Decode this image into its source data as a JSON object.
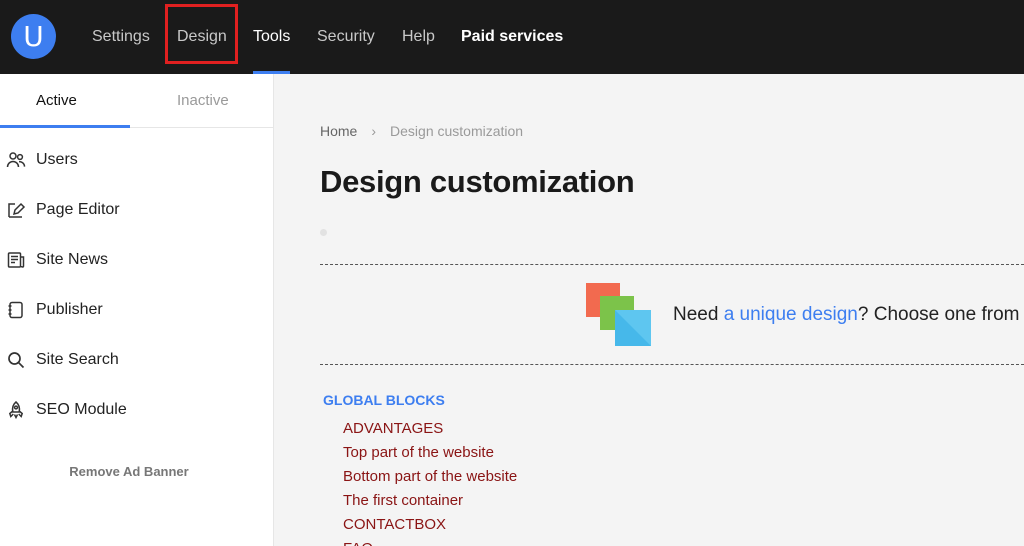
{
  "header": {
    "logo_letter": "U",
    "nav": [
      {
        "label": "Settings"
      },
      {
        "label": "Design"
      },
      {
        "label": "Tools"
      },
      {
        "label": "Security"
      },
      {
        "label": "Help"
      },
      {
        "label": "Paid services"
      }
    ]
  },
  "sidebar": {
    "tabs": {
      "active": "Active",
      "inactive": "Inactive"
    },
    "items": [
      {
        "label": "Users",
        "icon": "users-icon"
      },
      {
        "label": "Page Editor",
        "icon": "page-editor-icon"
      },
      {
        "label": "Site News",
        "icon": "news-icon"
      },
      {
        "label": "Publisher",
        "icon": "publisher-icon"
      },
      {
        "label": "Site Search",
        "icon": "search-icon"
      },
      {
        "label": "SEO Module",
        "icon": "rocket-icon"
      }
    ],
    "remove_ad": "Remove Ad Banner"
  },
  "main": {
    "breadcrumb": {
      "home": "Home",
      "sep": "›",
      "current": "Design customization"
    },
    "title": "Design customization",
    "promo": {
      "before": "Need ",
      "link": "a unique design",
      "after": "? Choose one from"
    },
    "blocks": {
      "heading": "GLOBAL BLOCKS",
      "items": [
        "ADVANTAGES",
        "Top part of the website",
        "Bottom part of the website",
        "The first container",
        "CONTACTBOX",
        "FAQ"
      ]
    }
  },
  "colors": {
    "accent": "#3d7ef0",
    "topbar": "#1a1a1a",
    "block_link": "#8a1414",
    "highlight": "#e02020"
  }
}
